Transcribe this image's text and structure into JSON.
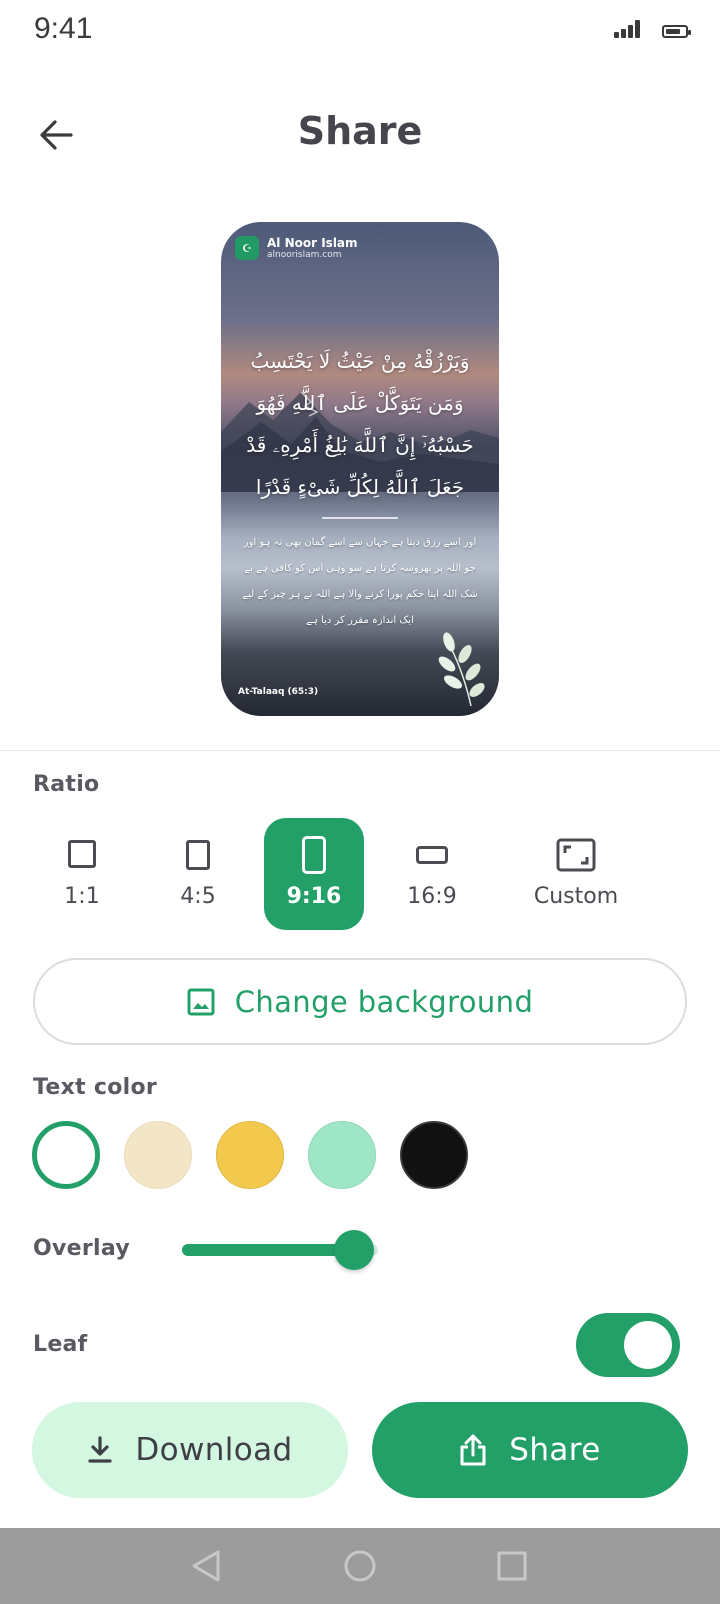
{
  "status_bar": {
    "time": "9:41",
    "signal_icon": "signal-icon",
    "battery_icon": "battery-icon"
  },
  "header": {
    "title": "Share",
    "back_icon": "arrow-left-icon"
  },
  "preview": {
    "brand_name": "Al Noor Islam",
    "brand_url": "alnoorislam.com",
    "arabic_text": "وَيَرْزُقْهُ مِنْ حَيْثُ لَا يَحْتَسِبُ وَمَن يَتَوَكَّلْ عَلَى ٱللَّهِ فَهُوَ حَسْبُهُۥٓ إِنَّ ٱللَّهَ بَٰلِغُ أَمْرِهِۦ قَدْ جَعَلَ ٱللَّهُ لِكُلِّ شَىْءٍ قَدْرًا",
    "urdu_text": "اور اسے رزق دیتا ہے جہاں سے اسے گمان بھی نہ ہو اور جو اللہ پر بھروسہ کرتا ہے سو وہی اس کو کافی ہے بے شک اللہ اپنا حکم پورا کرنے والا ہے اللہ نے ہر چیز کے لیے ایک اندازہ مقرر کر دیا ہے",
    "reference": "At-Talaaq (65:3)"
  },
  "ratio": {
    "label": "Ratio",
    "options": [
      {
        "label": "1:1",
        "icon": "square-icon"
      },
      {
        "label": "4:5",
        "icon": "portrait-icon"
      },
      {
        "label": "9:16",
        "icon": "phone-icon"
      },
      {
        "label": "16:9",
        "icon": "landscape-icon"
      },
      {
        "label": "Custom",
        "icon": "custom-crop-icon"
      }
    ],
    "selected": "9:16"
  },
  "background_button": {
    "label": "Change background",
    "icon": "image-icon"
  },
  "text_color": {
    "label": "Text color",
    "swatches": [
      "#ffffff",
      "#f3e6c7",
      "#f2c94c",
      "#9fe6c6",
      "#111111"
    ],
    "selected": "#ffffff",
    "ring_color": "#23a068"
  },
  "overlay": {
    "label": "Overlay",
    "value": 0.88
  },
  "leaf": {
    "label": "Leaf",
    "enabled": true
  },
  "actions": {
    "download_label": "Download",
    "download_icon": "download-icon",
    "share_label": "Share",
    "share_icon": "share-icon"
  },
  "nav": {
    "back_icon": "nav-back-icon",
    "home_icon": "nav-home-icon",
    "recents_icon": "nav-recents-icon"
  },
  "colors": {
    "accent": "#23a068",
    "accent_light": "#d3f7e0",
    "text": "#3f3f46"
  }
}
